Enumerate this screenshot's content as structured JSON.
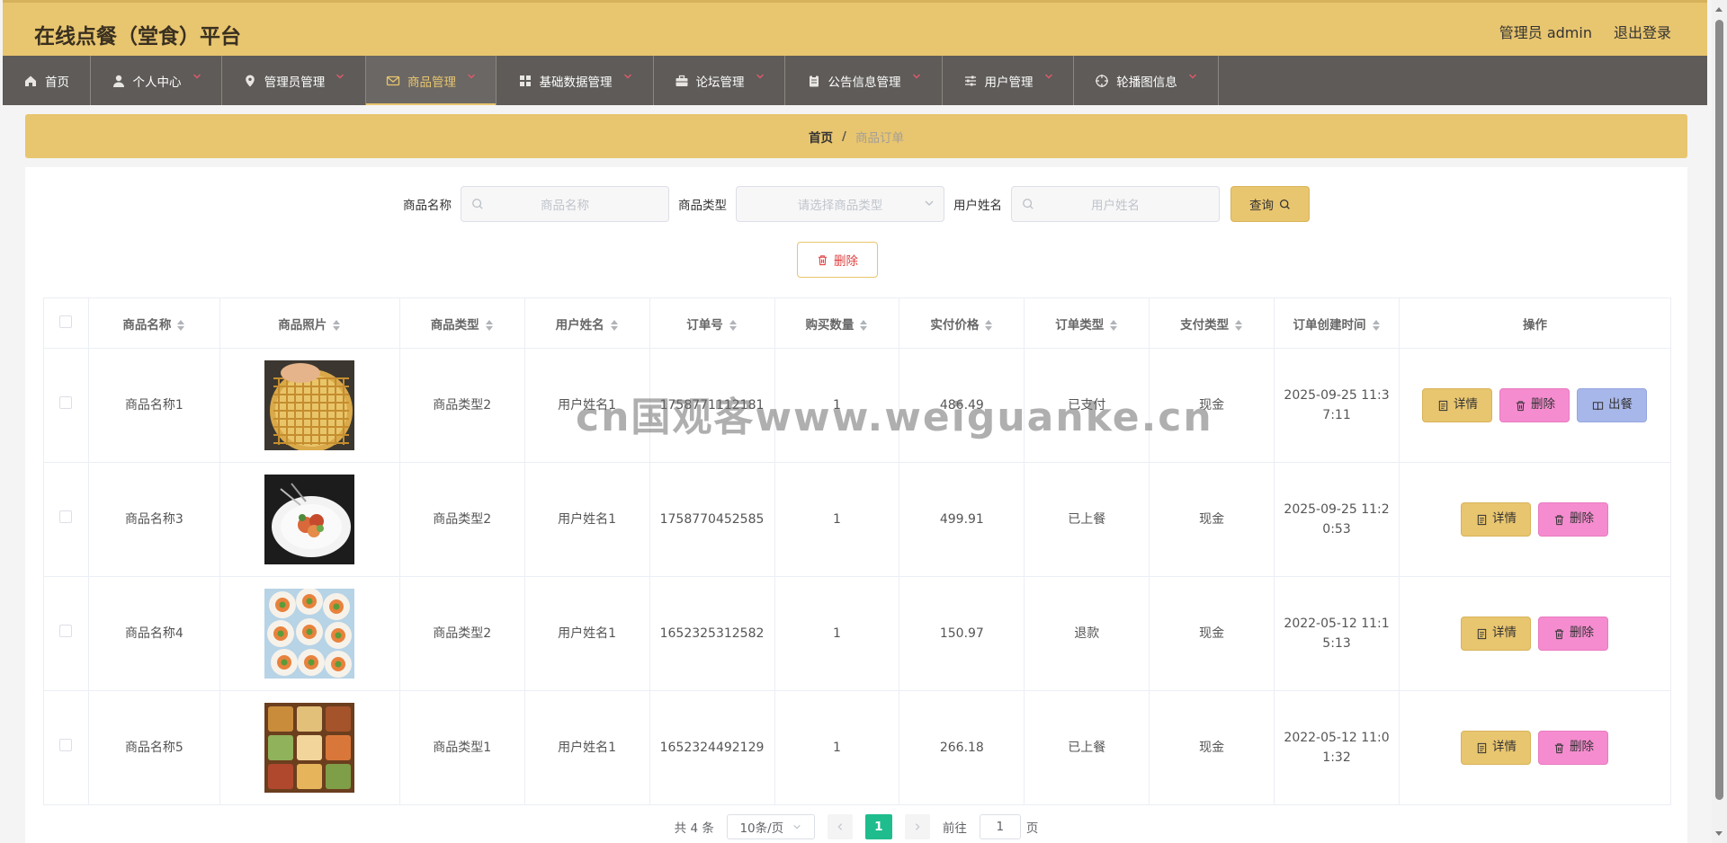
{
  "header": {
    "title": "在线点餐（堂食）平台",
    "admin_label": "管理员 admin",
    "logout_label": "退出登录"
  },
  "nav": [
    {
      "label": "首页",
      "icon": "home-icon",
      "has_caret": false,
      "active": false
    },
    {
      "label": "个人中心",
      "icon": "user-icon",
      "has_caret": true,
      "active": false
    },
    {
      "label": "管理员管理",
      "icon": "location-icon",
      "has_caret": true,
      "active": false
    },
    {
      "label": "商品管理",
      "icon": "mail-icon",
      "has_caret": true,
      "active": true
    },
    {
      "label": "基础数据管理",
      "icon": "grid-icon",
      "has_caret": true,
      "active": false
    },
    {
      "label": "论坛管理",
      "icon": "briefcase-icon",
      "has_caret": true,
      "active": false
    },
    {
      "label": "公告信息管理",
      "icon": "clipboard-icon",
      "has_caret": true,
      "active": false
    },
    {
      "label": "用户管理",
      "icon": "sliders-icon",
      "has_caret": true,
      "active": false
    },
    {
      "label": "轮播图信息",
      "icon": "crosshair-icon",
      "has_caret": true,
      "active": false
    }
  ],
  "breadcrumb": {
    "home": "首页",
    "separator": "/",
    "current": "商品订单"
  },
  "search": {
    "name_label": "商品名称",
    "name_placeholder": "商品名称",
    "type_label": "商品类型",
    "type_placeholder": "请选择商品类型",
    "user_label": "用户姓名",
    "user_placeholder": "用户姓名",
    "query_label": "查询"
  },
  "delete_label": "删除",
  "table": {
    "columns": [
      "商品名称",
      "商品照片",
      "商品类型",
      "用户姓名",
      "订单号",
      "购买数量",
      "实付价格",
      "订单类型",
      "支付类型",
      "订单创建时间",
      "操作"
    ],
    "rows": [
      {
        "name": "商品名称1",
        "type": "商品类型2",
        "user": "用户姓名1",
        "order_no": "1758771112181",
        "qty": "1",
        "price": "486.49",
        "order_type": "已支付",
        "pay": "现金",
        "time": "2025-09-25 11:37:11",
        "time_l1": "2025-09-25 11:3",
        "time_l2": "7:11",
        "actions": [
          "详情",
          "删除",
          "出餐"
        ]
      },
      {
        "name": "商品名称3",
        "type": "商品类型2",
        "user": "用户姓名1",
        "order_no": "1758770452585",
        "qty": "1",
        "price": "499.91",
        "order_type": "已上餐",
        "pay": "现金",
        "time_l1": "2025-09-25 11:2",
        "time_l2": "0:53",
        "actions": [
          "详情",
          "删除"
        ]
      },
      {
        "name": "商品名称4",
        "type": "商品类型2",
        "user": "用户姓名1",
        "order_no": "1652325312582",
        "qty": "1",
        "price": "150.97",
        "order_type": "退款",
        "pay": "现金",
        "time_l1": "2022-05-12 11:1",
        "time_l2": "5:13",
        "actions": [
          "详情",
          "删除"
        ]
      },
      {
        "name": "商品名称5",
        "type": "商品类型1",
        "user": "用户姓名1",
        "order_no": "1652324492129",
        "qty": "1",
        "price": "266.18",
        "order_type": "已上餐",
        "pay": "现金",
        "time_l1": "2022-05-12 11:0",
        "time_l2": "1:32",
        "actions": [
          "详情",
          "删除"
        ]
      }
    ]
  },
  "watermark": "cn国观客www.weiguanke.cn",
  "pagination": {
    "total": "共 4 条",
    "page_size": "10条/页",
    "current_page": "1",
    "goto_label": "前往",
    "goto_value": "1",
    "page_suffix": "页"
  },
  "colors": {
    "accent": "#e8c56f",
    "nav_bg": "#5e5b58",
    "delete_pink": "#f58ccf",
    "serve_blue": "#a8b7ea",
    "pager_active": "#1fbd8d"
  }
}
